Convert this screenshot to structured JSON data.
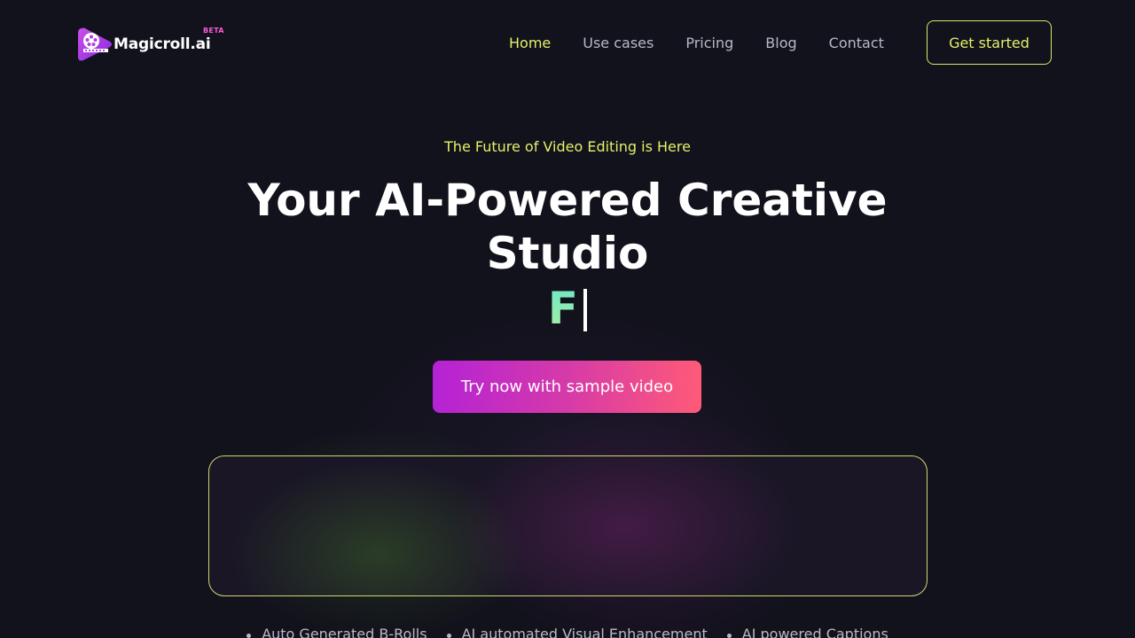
{
  "brand": {
    "name": "Magicroll.ai",
    "badge": "BETA",
    "accent": "#e4f06a",
    "gradient_start": "#b422d6",
    "gradient_end": "#ff5a78"
  },
  "nav": {
    "items": [
      {
        "label": "Home",
        "active": true
      },
      {
        "label": "Use cases",
        "active": false
      },
      {
        "label": "Pricing",
        "active": false
      },
      {
        "label": "Blog",
        "active": false
      },
      {
        "label": "Contact",
        "active": false
      }
    ],
    "cta_label": "Get started"
  },
  "hero": {
    "eyebrow": "The Future of Video Editing is Here",
    "headline": "Your AI-Powered Creative Studio",
    "typing_text": "F",
    "cta_label": "Try now with sample video"
  },
  "features": [
    "Auto Generated B-Rolls",
    "AI automated Visual Enhancement",
    "AI powered Captions"
  ]
}
